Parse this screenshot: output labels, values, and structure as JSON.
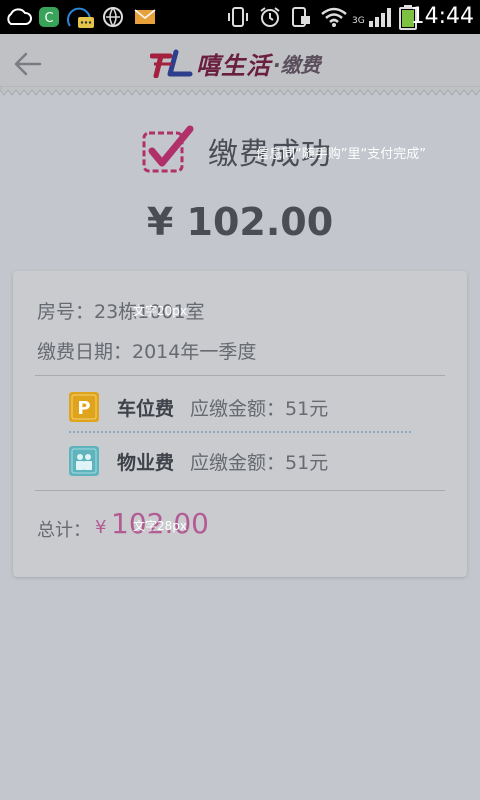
{
  "status_bar": {
    "time": "14:44",
    "network": "3G",
    "icons": [
      "cloud-icon",
      "app-shield-icon",
      "qq-chat-icon",
      "globe-icon",
      "mail-icon",
      "vibrate-icon",
      "alarm-icon",
      "screenshot-icon",
      "wifi-icon",
      "signal-icon",
      "battery-icon"
    ]
  },
  "header": {
    "logo_mark": "TL",
    "logo_text": "嘻生活",
    "logo_sub": "·缴费"
  },
  "success": {
    "title": "缴费成功",
    "note": "信息同“随手购”里“支付完成”",
    "amount": "¥ 102.00"
  },
  "details": {
    "room": "房号：23栋1001室",
    "room_note": "文字20px",
    "date": "缴费日期：2014年一季度",
    "fees": [
      {
        "name": "车位费",
        "amount": "应缴金额：51元",
        "icon": "parking-icon"
      },
      {
        "name": "物业费",
        "amount": "应缴金额：51元",
        "icon": "property-icon"
      }
    ],
    "total_label": "总计：",
    "total_currency": "¥",
    "total_value": "102.00",
    "total_note": "文字28px"
  },
  "colors": {
    "accent": "#b35c93",
    "parking": "#e0a31c",
    "property": "#5fb3bd",
    "status_bar": "#000000"
  }
}
